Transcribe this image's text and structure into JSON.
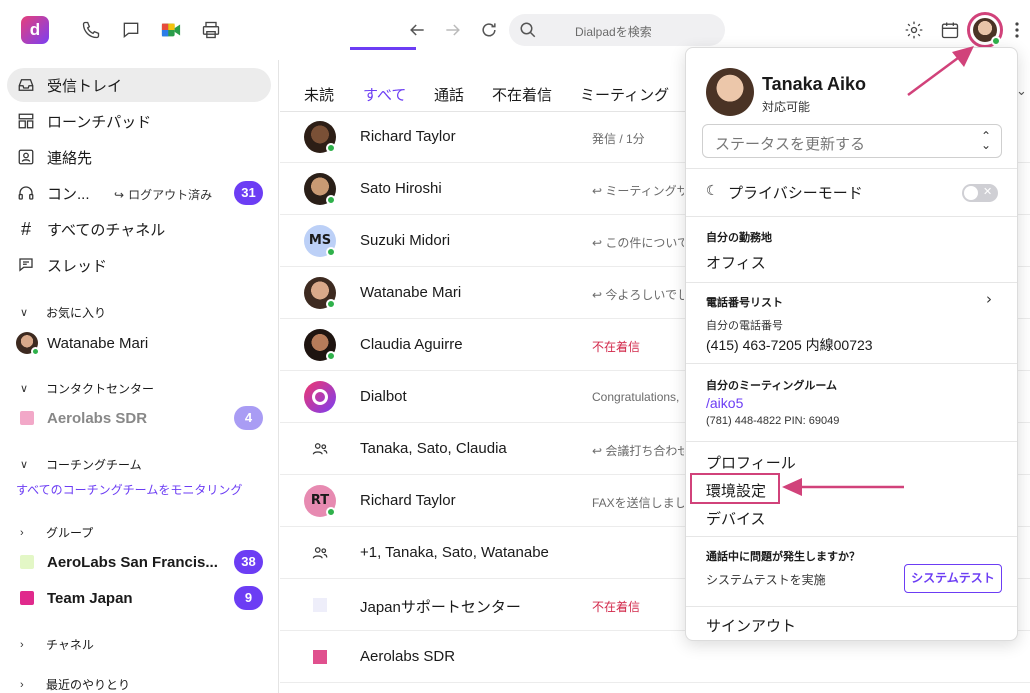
{
  "topbar": {
    "logo": "d",
    "search_placeholder": "Dialpadを検索"
  },
  "sidebar": {
    "items": [
      {
        "label": "受信トレイ",
        "icon": "inbox-icon"
      },
      {
        "label": "ローンチパッド",
        "icon": "launchpad-icon"
      },
      {
        "label": "連絡先",
        "icon": "contacts-icon"
      },
      {
        "label": "コン...",
        "icon": "headset-icon",
        "logout": "ログアウト済み",
        "badge": "31"
      },
      {
        "label": "すべてのチャネル",
        "icon": "hash-icon"
      },
      {
        "label": "スレッド",
        "icon": "thread-icon"
      }
    ],
    "favorites_title": "お気に入り",
    "favorite": "Watanabe Mari",
    "contact_center_title": "コンタクトセンター",
    "contact_center_item": "Aerolabs SDR",
    "contact_center_badge": "4",
    "coaching_title": "コーチングチーム",
    "coaching_link": "すべてのコーチングチームをモニタリング",
    "groups_title": "グループ",
    "groups": [
      {
        "label": "AeroLabs San Francis...",
        "badge": "38",
        "color": "#e3f7c6"
      },
      {
        "label": "Team Japan",
        "badge": "9",
        "color": "#e02a8c"
      }
    ],
    "channels_title": "チャネル",
    "recent_title": "最近のやりとり"
  },
  "tabs": [
    "未読",
    "すべて",
    "通話",
    "不在着信",
    "ミーティング"
  ],
  "rows": [
    {
      "name": "Richard Taylor",
      "preview": "発信 / 1分",
      "red": false,
      "avatar": "photo"
    },
    {
      "name": "Sato Hiroshi",
      "preview": "↩ ミーティングサ",
      "red": false,
      "avatar": "photo"
    },
    {
      "name": "Suzuki Midori",
      "preview": "↩ この件について",
      "red": false,
      "avatar": "MS"
    },
    {
      "name": "Watanabe Mari",
      "preview": "↩ 今よろしいでし",
      "red": false,
      "avatar": "photo"
    },
    {
      "name": "Claudia Aguirre",
      "preview": "不在着信",
      "red": true,
      "avatar": "photo"
    },
    {
      "name": "Dialbot",
      "preview": "Congratulations,",
      "red": false,
      "avatar": "bot"
    },
    {
      "name": "Tanaka, Sato, Claudia",
      "preview": "↩ 会議打ち合わせ",
      "red": false,
      "avatar": "group"
    },
    {
      "name": "Richard Taylor",
      "preview": "FAXを送信しまし",
      "red": false,
      "avatar": "RT"
    },
    {
      "name": "+1, Tanaka, Sato, Watanabe",
      "preview": "",
      "red": false,
      "avatar": "group"
    },
    {
      "name": "Japanサポートセンター",
      "preview": "不在着信",
      "red": true,
      "avatar": "sq-light"
    },
    {
      "name": "Aerolabs SDR",
      "preview": "",
      "red": false,
      "avatar": "sq-pink"
    }
  ],
  "menu": {
    "user_name": "Tanaka Aiko",
    "user_status": "対応可能",
    "status_placeholder": "ステータスを更新する",
    "privacy_mode": "プライバシーモード",
    "work_location_title": "自分の勤務地",
    "work_location": "オフィス",
    "phone_list_title": "電話番号リスト",
    "my_phone_title": "自分の電話番号",
    "my_phone": "(415) 463-7205 内線00723",
    "meeting_room_title": "自分のミーティングルーム",
    "meeting_link": "/aiko5",
    "meeting_dial": "(781) 448-4822 PIN: 69049",
    "profile": "プロフィール",
    "preferences": "環境設定",
    "devices": "デバイス",
    "problem_title": "通話中に問題が発生しますか？",
    "system_test_desc": "システムテストを実施",
    "system_test_button": "システムテスト",
    "sign_out": "サインアウト"
  },
  "colors": {
    "accent": "#6c3df4",
    "highlight": "#d1427a",
    "online": "#2fb14b",
    "missed": "#d2294b"
  }
}
